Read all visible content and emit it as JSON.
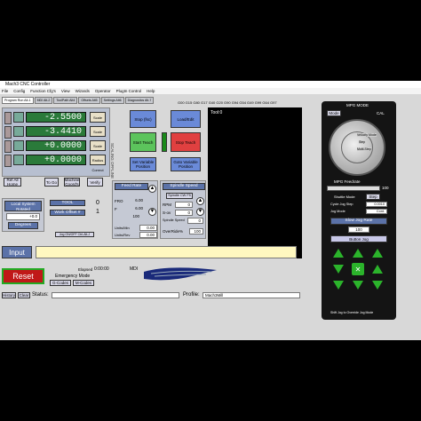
{
  "window": {
    "title": "Mach3 CNC Controller"
  },
  "menu": [
    "File",
    "Config",
    "Function Cfg's",
    "View",
    "Wizards",
    "Operator",
    "PlugIn Control",
    "Help"
  ],
  "tabs": [
    "Program Run Alt-1",
    "MDI Alt-2",
    "ToolPath Alt4",
    "Offsets Alt5",
    "Settings Alt6",
    "Diagnostics Alt-7"
  ],
  "gcodes": "G00 G15 G80 G17 G40 G20 G90 G94 G54 G49 G99 G64 G97",
  "dro": {
    "axes": [
      "X",
      "Y",
      "Z",
      "4"
    ],
    "values": [
      "-2.5500",
      "-3.4410",
      "+0.0000",
      "+0.0000"
    ],
    "ref_labels": [
      "Scale",
      "Scale",
      "Scale",
      "Radius Correct"
    ],
    "axis_side_label": "REF ALL HOME",
    "machine_coords_label": "Machine Coord's",
    "soft_limits_label": "Soft Limits",
    "verify_label": "Verify",
    "ref_all_label": "Ref All Home",
    "goto_zero_label": "To Go",
    "offline_label": "OFFLINE",
    "scaling_label": "SCALING OFFLINE"
  },
  "file": {
    "name": "Tool:0"
  },
  "buttons": {
    "stop_fsc": "Stop (fsc)",
    "load_edit": "Load/Edit",
    "start_teach": "Start Teach",
    "stop_teach": "Stop Teach",
    "set_variable": "Set Variable Position",
    "goto_variable": "Goto Variable Position",
    "reset": "Reset",
    "input": "Input",
    "jog_label": "Jog ON/OFF Ctrl-Alt-J",
    "gcodes_btn": "G-Codes",
    "mcodes_btn": "M-Codes",
    "history_btn": "History",
    "clear_btn": "Clear",
    "degrees": "Degrees"
  },
  "tool": {
    "local_system": "Local System Rotated",
    "rotation": "+0.0",
    "tool_label": "TOOL",
    "tool_value": "0",
    "work_offset_label": "Work Offset #",
    "work_offset_value": "1"
  },
  "feed": {
    "header": "Feed Rate",
    "fro_label": "FRO",
    "fro_value": "6.00",
    "f_label": "F",
    "f_value": "6.00",
    "percent": "100",
    "units_min": "0.00",
    "units_rev": "0.00",
    "units_min_label": "Units/Min",
    "units_rev_label": "Units/Rev"
  },
  "spindle": {
    "header": "Spindle Speed",
    "cw_label": "Spindle CW F5",
    "rpm_label": "RPM",
    "rpm_value": "0",
    "sov_label": "S-ov",
    "sov_value": "0",
    "spindle_speed_label": "Spindle Speed",
    "spindle_speed_value": "0",
    "override_label": "OverRide%",
    "override_value": "100"
  },
  "status": {
    "elapsed_label": "Elapsed",
    "elapsed_value": "0:00:00",
    "mdi_label": "MDI",
    "emergency": "Emergency Mode",
    "status_label": "Status:",
    "profile_label": "Profile:",
    "profile_value": "Mach3Mill"
  },
  "mpg": {
    "mode_label": "MPG MODE",
    "mode_btn": "Mode",
    "cal_label": "CAL",
    "options": [
      "Velocity Mode",
      "Step",
      "Multi-Step"
    ],
    "feedrate_label": "MPG Feedrate",
    "feedrate_value": "100",
    "shuttle_label": "Shuttle Mode",
    "step_label": "Step",
    "cycle_jog_label": "Cycle Jog Step",
    "cycle_jog_value": "0.0010",
    "jog_mode_label": "Jog Mode",
    "jog_mode_value": "Cont.",
    "slow_jog_label": "Slow Jog Rate",
    "slow_jog_value": "100",
    "button_jog": "Button Jog",
    "footer": "Shift Jog to Override Jog Mode"
  },
  "colors": {
    "dro_green": "#2a7a3a",
    "header_blue": "#5b72a8",
    "reset_red": "#e04040",
    "window_gray": "#d8d8d8"
  }
}
